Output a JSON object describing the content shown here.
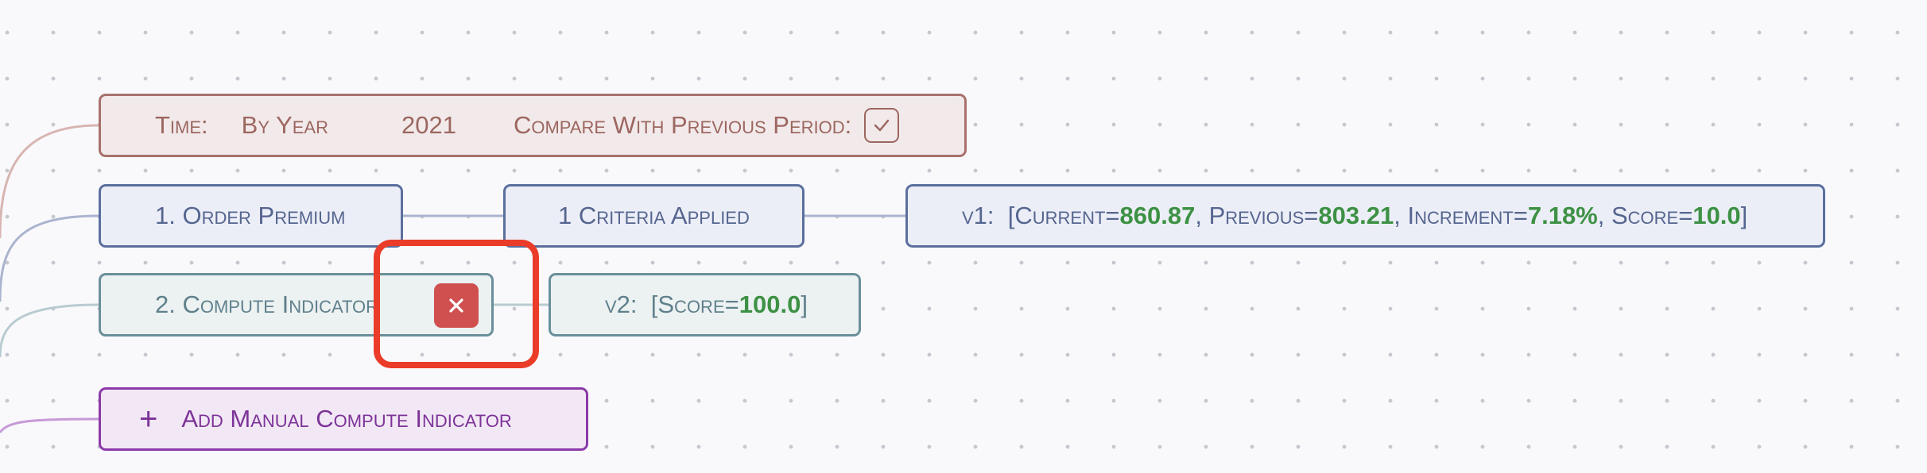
{
  "time_filter": {
    "label": "Time:",
    "granularity": "By Year",
    "year": "2021",
    "compare_label": "Compare With Previous Period:",
    "compare_checked": true
  },
  "steps": [
    {
      "title": "1.  Order Premium",
      "criteria": "1 Criteria Applied",
      "result": {
        "name": "v1:",
        "open": "[Current=",
        "current": "860.87",
        "sep1": ",  Previous=",
        "previous": "803.21",
        "sep2": ",  Increment=",
        "increment": "7.18%",
        "sep3": ",  Score=",
        "score": "10.0",
        "close": "]"
      }
    },
    {
      "title": "2.  Compute Indicator",
      "result": {
        "name": "v2:",
        "open": "[Score=",
        "score": "100.0",
        "close": "]"
      }
    }
  ],
  "add_button": {
    "icon": "+",
    "label": "Add Manual Compute Indicator"
  },
  "icons": {
    "compare_checkbox": "check-icon",
    "remove": "close-icon",
    "add": "plus-icon"
  },
  "colors": {
    "time": "#9c6760",
    "step": "#55658f",
    "compute": "#5f808b",
    "add": "#7c3398",
    "value_green": "#3d9144",
    "delete_red": "#d05050",
    "highlight": "#ea3c29"
  }
}
